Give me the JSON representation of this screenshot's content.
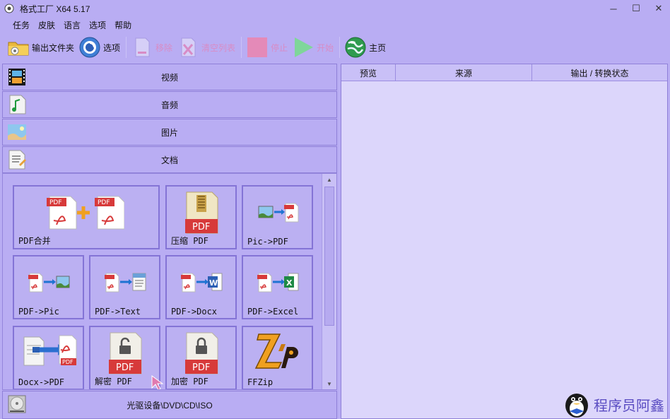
{
  "window": {
    "title": "格式工厂 X64 5.17",
    "minimize": "─",
    "maximize": "☐",
    "close": "✕"
  },
  "menu": [
    "任务",
    "皮肤",
    "语言",
    "选项",
    "帮助"
  ],
  "toolbar": {
    "output_folder": "输出文件夹",
    "options": "选项",
    "remove": "移除",
    "clear_list": "清空列表",
    "stop": "停止",
    "start": "开始",
    "home": "主页"
  },
  "categories": {
    "video": "视频",
    "audio": "音频",
    "picture": "图片",
    "document": "文档",
    "disc": "光驱设备\\DVD\\CD\\ISO"
  },
  "tiles": [
    {
      "label": "PDF合并",
      "icon": "pdf-merge-icon"
    },
    {
      "label": "压缩 PDF",
      "icon": "pdf-compress-icon"
    },
    {
      "label": "Pic->PDF",
      "icon": "pic-to-pdf-icon"
    },
    {
      "label": "PDF->Pic",
      "icon": "pdf-to-pic-icon"
    },
    {
      "label": "PDF->Text",
      "icon": "pdf-to-text-icon"
    },
    {
      "label": "PDF->Docx",
      "icon": "pdf-to-docx-icon"
    },
    {
      "label": "PDF->Excel",
      "icon": "pdf-to-excel-icon"
    },
    {
      "label": "Docx->PDF",
      "icon": "docx-to-pdf-icon"
    },
    {
      "label": "解密 PDF",
      "icon": "pdf-decrypt-icon"
    },
    {
      "label": "加密 PDF",
      "icon": "pdf-encrypt-icon"
    },
    {
      "label": "FFZip",
      "icon": "ffzip-icon"
    }
  ],
  "task_table": {
    "columns": [
      "预览",
      "来源",
      "输出 / 转换状态"
    ]
  },
  "watermark": "程序员阿鑫",
  "colors": {
    "background": "#b9adf3",
    "pdf_red": "#d73a3a",
    "tile_border": "#8474d6"
  }
}
